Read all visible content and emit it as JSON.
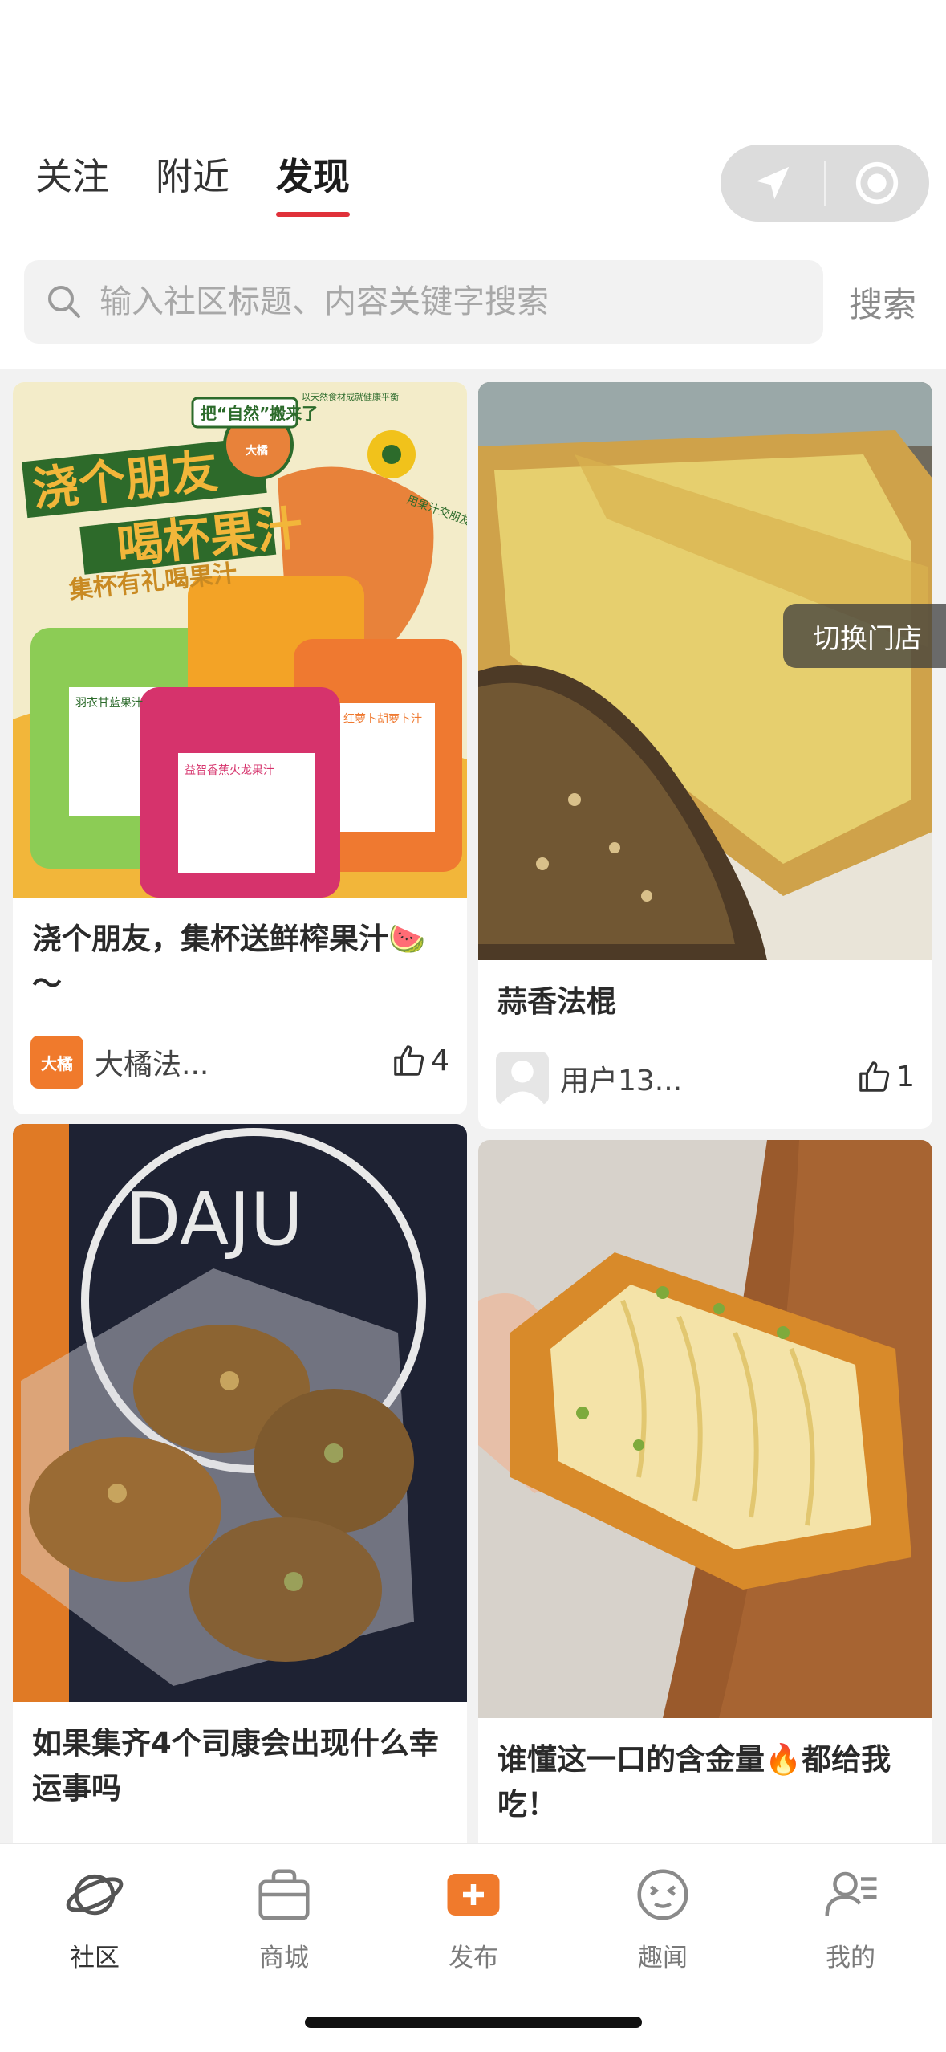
{
  "header": {
    "tabs": [
      {
        "label": "关注"
      },
      {
        "label": "附近"
      },
      {
        "label": "发现"
      }
    ],
    "active_tab": "发现"
  },
  "search": {
    "placeholder": "输入社区标题、内容关键字搜索",
    "button_label": "搜索"
  },
  "overlay": {
    "switch_store_label": "切换门店"
  },
  "feed": {
    "posts": [
      {
        "title": "浇个朋友，集杯送鲜榨果汁🍉～",
        "author": "大橘法...",
        "likes": "4",
        "image_text": {
          "headline1": "浇个朋友",
          "headline2": "喝杯果汁",
          "sub": "集杯有礼喝果汁",
          "badge": "把“自然”搬来了",
          "tiny": "以天然食材成就健康平衡",
          "side": "用果汁交朋友",
          "cup1": "羽衣甘蓝果汁",
          "cup2": "益智香蕉火龙果汁",
          "cup3": "红萝卜胡萝卜汁",
          "brand": "大橘"
        },
        "avatar_text": "大橘"
      },
      {
        "title": "蒜香法棍",
        "author": "用户13...",
        "likes": "1"
      },
      {
        "title": "如果集齐4个司康会出现什么幸运事吗",
        "image_text": {
          "sign": "DAJU"
        }
      },
      {
        "title": "谁懂这一口的含金量🔥都给我吃！"
      }
    ]
  },
  "bottom_nav": {
    "items": [
      {
        "label": "社区",
        "icon": "planet-icon"
      },
      {
        "label": "商城",
        "icon": "shopping-bag-icon"
      },
      {
        "label": "发布",
        "icon": "plus-icon"
      },
      {
        "label": "趣闻",
        "icon": "funny-face-icon"
      },
      {
        "label": "我的",
        "icon": "user-icon"
      }
    ],
    "active": "社区"
  },
  "colors": {
    "accent_red": "#e0313a",
    "publish_orange": "#f07a2c"
  }
}
